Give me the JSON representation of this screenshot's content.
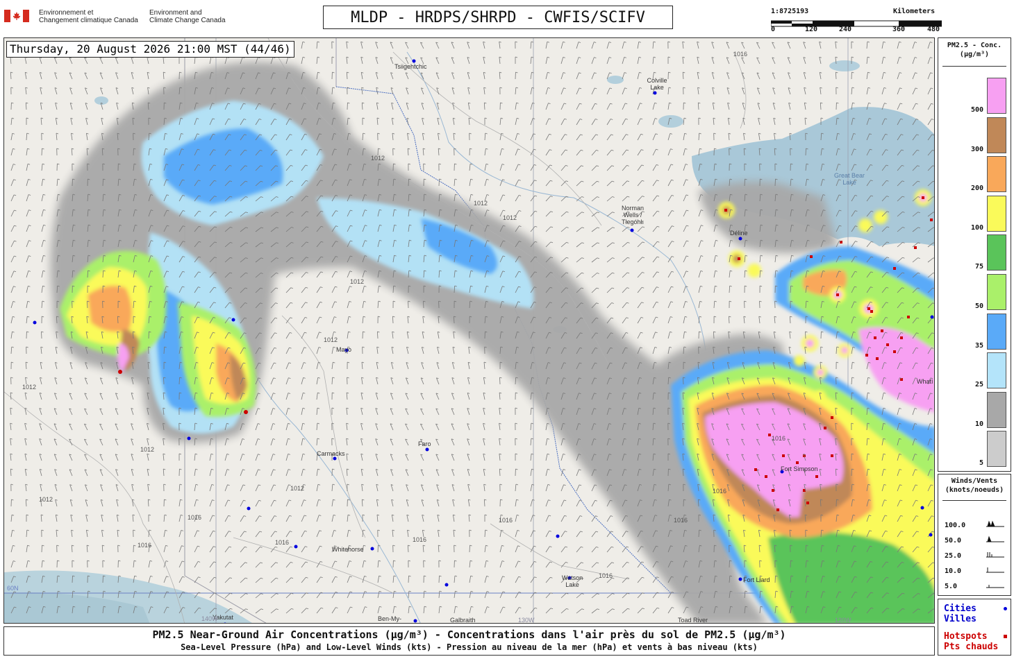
{
  "header": {
    "agency_fr": "Environnement et\nChangement climatique Canada",
    "agency_en": "Environment and\nClimate Change Canada",
    "title": "MLDP - HRDPS/SHRPD - CWFIS/SCIFV",
    "scale_ratio": "1:8725193",
    "scale_unit": "Kilometers",
    "scale_ticks": [
      "0",
      "120",
      "240",
      "360",
      "480"
    ]
  },
  "map": {
    "timestamp": "Thursday, 20 August 2026 21:00 MST (44/46)",
    "places": [
      {
        "name": "Tsiigehtchic"
      },
      {
        "name": "Colville Lake"
      },
      {
        "name": "Great Bear Lake"
      },
      {
        "name": "Norman Wells / Tłegóhłı"
      },
      {
        "name": "Déline"
      },
      {
        "name": "Mayo"
      },
      {
        "name": "Faro"
      },
      {
        "name": "Carmacks"
      },
      {
        "name": "Whitehorse"
      },
      {
        "name": "Watson Lake"
      },
      {
        "name": "Fort Simpson"
      },
      {
        "name": "Fort Liard"
      },
      {
        "name": "Yakutat"
      },
      {
        "name": "Ben-My-"
      },
      {
        "name": "Galbraith"
      },
      {
        "name": "Toad River"
      },
      {
        "name": "Whatì"
      }
    ],
    "graticule_labels": [
      "60N",
      "140W",
      "130W",
      "120W"
    ],
    "isobar_labels": [
      "1012",
      "1016"
    ]
  },
  "legend": {
    "title": "PM2.5 - Conc.",
    "unit": "(µg/m³)",
    "levels": [
      {
        "value": "500",
        "color": "#f7a0f2"
      },
      {
        "value": "300",
        "color": "#c08858"
      },
      {
        "value": "200",
        "color": "#f9a85a"
      },
      {
        "value": "100",
        "color": "#fafa5a"
      },
      {
        "value": "75",
        "color": "#5ac45a"
      },
      {
        "value": "50",
        "color": "#aaf06a"
      },
      {
        "value": "35",
        "color": "#5aaaf8"
      },
      {
        "value": "25",
        "color": "#b4e4fa"
      },
      {
        "value": "10",
        "color": "#a8a8a8"
      },
      {
        "value": "5",
        "color": "#cccccc"
      }
    ]
  },
  "winds": {
    "title": "Winds/Vents",
    "unit": "(knots/noeuds)",
    "speeds": [
      "100.0",
      "50.0",
      "25.0",
      "10.0",
      "5.0"
    ]
  },
  "markers": {
    "cities_en": "Cities",
    "cities_fr": "Villes",
    "hotspots_en": "Hotspots",
    "hotspots_fr": "Pts chauds",
    "city_color": "#0000dd",
    "hotspot_color": "#cc0000"
  },
  "caption": {
    "line1": "PM2.5 Near-Ground Air Concentrations (µg/m³) - Concentrations dans l'air près du sol de PM2.5 (µg/m³)",
    "line2": "Sea-Level Pressure (hPa) and Low-Level Winds (kts) - Pression au niveau de la mer (hPa) et vents à bas niveau (kts)"
  }
}
